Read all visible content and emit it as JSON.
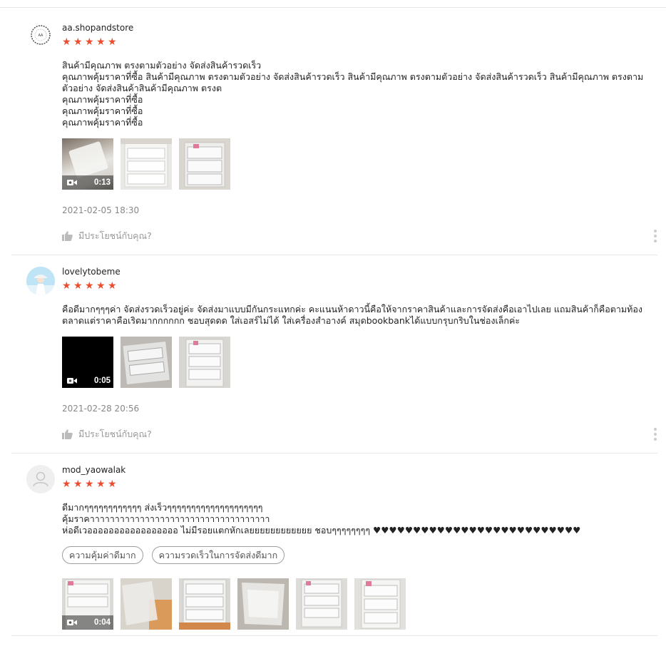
{
  "reviews": [
    {
      "username": "aa.shopandstore",
      "rating": 5,
      "lines": [
        "สินค้ามีคุณภาพ ตรงตามตัวอย่าง จัดส่งสินค้ารวดเร็ว",
        "คุณภาพคุ้มราคาที่ซื้อ สินค้ามีคุณภาพ ตรงตามตัวอย่าง จัดส่งสินค้ารวดเร็ว สินค้ามีคุณภาพ ตรงตามตัวอย่าง จัดส่งสินค้ารวดเร็ว สินค้ามีคุณภาพ ตรงตามตัวอย่าง จัดส่งสินค้าสินค้ามีคุณภาพ ตรงต",
        "คุณภาพคุ้มราคาที่ซื้อ",
        "คุณภาพคุ้มราคาที่ซื้อ",
        "คุณภาพคุ้มราคาที่ซื้อ"
      ],
      "tags": [],
      "video_duration": "0:13",
      "date": "2021-02-05 18:30",
      "helpful_label": "มีประโยชน์กับคุณ?"
    },
    {
      "username": "lovelytobeme",
      "rating": 5,
      "lines": [
        "คือดีมากๆๆๆค่า จัดส่งรวดเร็วอยู่ค่ะ จัดส่งมาแบบมีกันกระแทกค่ะ คะแนนห้าดาวนี้คือให้จากราคาสินค้าและการจัดส่งคือเอาไปเลย แถมสินค้าก็คือตามท้องตลาดแต่ราคาคือเริดมากกกกกก ชอบสุดดด ใส่เอสร์ไม่ได้ ใส่เครื่องสำอางค์ สมุดbookbankได้แบบกรุบกริบในช่องเล็กค่ะ"
      ],
      "tags": [],
      "video_duration": "0:05",
      "date": "2021-02-28 20:56",
      "helpful_label": "มีประโยชน์กับคุณ?"
    },
    {
      "username": "mod_yaowalak",
      "rating": 5,
      "lines": [
        "ดีมากๆๆๆๆๆๆๆๆๆๆๆๆ ส่งเร็วๆๆๆๆๆๆๆๆๆๆๆๆๆๆๆๆๆๆๆๆ",
        "คุ้มราคาาาาาาาาาาาาาาาาาาาาาาาาาาาาาาาาาาาา",
        "ห่อดีเวอออออออออออออออออ ไม่มีรอยแตกหักเลยยยยยยยยยยยย ชอบๆๆๆๆๆๆๆๆ ♥♥♥♥♥♥♥♥♥♥♥♥♥♥♥♥♥♥♥♥♥♥♥♥♥♥"
      ],
      "tags": [
        "ความคุ้มค่าดีมาก",
        "ความรวดเร็วในการจัดส่งดีมาก"
      ],
      "video_duration": "0:04",
      "date": "",
      "helpful_label": ""
    }
  ],
  "colors": {
    "star": "#ee4d2d",
    "muted": "#888888",
    "divider": "#e8e8e8"
  }
}
